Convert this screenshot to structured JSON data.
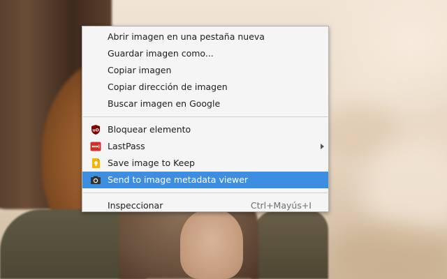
{
  "context_menu": {
    "group1": [
      {
        "label": "Abrir imagen en una pestaña nueva"
      },
      {
        "label": "Guardar imagen como..."
      },
      {
        "label": "Copiar imagen"
      },
      {
        "label": "Copiar dirección de imagen"
      },
      {
        "label": "Buscar imagen en Google"
      }
    ],
    "group2": [
      {
        "label": "Bloquear elemento",
        "icon": "ublock-origin-icon",
        "icon_color": "#800000"
      },
      {
        "label": "LastPass",
        "icon": "lastpass-icon",
        "icon_color": "#d32d27",
        "has_submenu": true
      },
      {
        "label": "Save image to Keep",
        "icon": "google-keep-icon",
        "icon_color": "#f6b400"
      },
      {
        "label": "Send to image metadata viewer",
        "icon": "camera-icon",
        "icon_color": "#333333",
        "highlighted": true
      }
    ],
    "group3": [
      {
        "label": "Inspeccionar",
        "shortcut": "Ctrl+Mayús+I"
      }
    ],
    "highlight_color": "#3d8ee0"
  }
}
